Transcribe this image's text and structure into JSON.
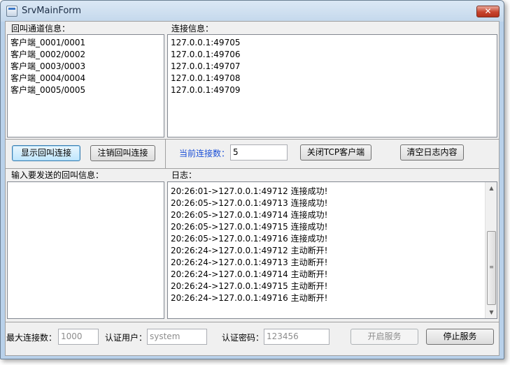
{
  "window": {
    "title": "SrvMainForm",
    "close_glyph": "✕"
  },
  "callback_panel": {
    "label": "回叫通道信息：",
    "items": [
      "客户端_0001/0001",
      "客户端_0002/0002",
      "客户端_0003/0003",
      "客户端_0004/0004",
      "客户端_0005/0005"
    ]
  },
  "connection_panel": {
    "label": "连接信息：",
    "items": [
      "127.0.0.1:49705",
      "127.0.0.1:49706",
      "127.0.0.1:49707",
      "127.0.0.1:49708",
      "127.0.0.1:49709"
    ]
  },
  "left_buttons": {
    "show": "显示回叫连接",
    "cancel": "注销回叫连接"
  },
  "status_row": {
    "current_label": "当前连接数：",
    "current_value": "5",
    "close_tcp": "关闭TCP客户端",
    "clear_log": "清空日志内容"
  },
  "message_panel": {
    "label": "输入要发送的回叫信息："
  },
  "log_panel": {
    "label": "日志：",
    "lines": [
      "20:26:01->127.0.0.1:49712 连接成功!",
      "20:26:05->127.0.0.1:49713 连接成功!",
      "20:26:05->127.0.0.1:49714 连接成功!",
      "20:26:05->127.0.0.1:49715 连接成功!",
      "20:26:05->127.0.0.1:49716 连接成功!",
      "20:26:24->127.0.0.1:49712 主动断开!",
      "20:26:24->127.0.0.1:49713 主动断开!",
      "20:26:24->127.0.0.1:49714 主动断开!",
      "20:26:24->127.0.0.1:49715 主动断开!",
      "20:26:24->127.0.0.1:49716 主动断开!"
    ]
  },
  "bottom_bar": {
    "max_label": "最大连接数：",
    "max_value": "1000",
    "user_label": "认证用户：",
    "user_value": "system",
    "pwd_label": "认证密码：",
    "pwd_value": "123456",
    "start": "开启服务",
    "stop": "停止服务"
  },
  "colors": {
    "accent_label": "#1b4fd6",
    "title_bar": "#c4d8ec",
    "close_button": "#c7442e"
  }
}
